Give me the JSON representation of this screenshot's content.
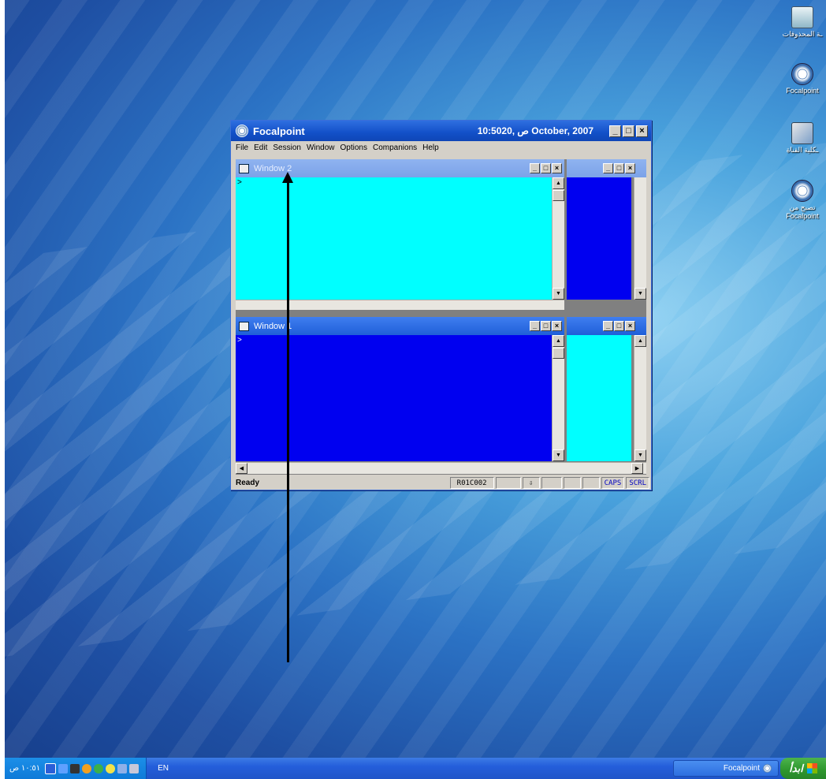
{
  "desktop": {
    "icons": [
      {
        "label": "ـة المحذوفات",
        "icon": "recycle-bin-icon"
      },
      {
        "label": "Focalpoint",
        "icon": "focalpoint-globe-icon"
      },
      {
        "label": "ـكلية القناة",
        "icon": "shortcut-window-icon"
      },
      {
        "label": "تصبح من Focalpoint",
        "icon": "focalpoint-globe-icon"
      }
    ]
  },
  "app": {
    "title": "Focalpoint",
    "datetime": "10:50ص ,20 October, 2007",
    "window_buttons": {
      "minimize": "_",
      "maximize": "□",
      "close": "×"
    },
    "menu": [
      "File",
      "Edit",
      "Session",
      "Window",
      "Options",
      "Companions",
      "Help"
    ],
    "panes": [
      {
        "title": "Window 2",
        "prompt": ">",
        "state": "inactive",
        "left_color": "#00ffff",
        "right_color": "#0000f0"
      },
      {
        "title": "Window 1",
        "prompt": ">",
        "state": "active",
        "left_color": "#0000f0",
        "right_color": "#00ffff"
      }
    ],
    "status": {
      "ready": "Ready",
      "position": "R01C002",
      "icon_box": "⇩",
      "caps": "CAPS",
      "scrl": "SCRL"
    }
  },
  "taskbar": {
    "clock": "١٠:٥١ ص",
    "language": "EN",
    "task_button": "Focalpoint",
    "start_label": "ابدأ"
  }
}
